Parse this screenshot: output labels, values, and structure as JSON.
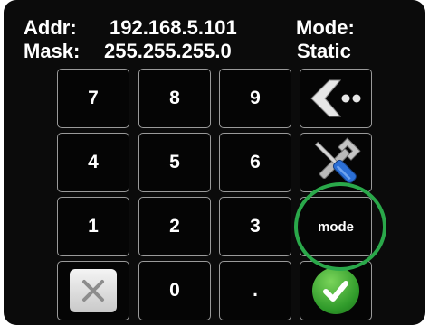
{
  "status": {
    "addr_label": "Addr:",
    "addr_value": "192.168.5.101",
    "mask_label": "Mask:",
    "mask_value": "255.255.255.0",
    "mode_label": "Mode:",
    "mode_value": "Static"
  },
  "keypad": {
    "keys": [
      "7",
      "8",
      "9",
      "4",
      "5",
      "6",
      "1",
      "2",
      "3",
      "0",
      "."
    ],
    "mode_button": "mode"
  },
  "icons": {
    "back": "back-arrow-icon",
    "settings": "tools-icon",
    "clear": "clear-x-icon",
    "confirm": "checkmark-icon"
  },
  "colors": {
    "background": "#0b0b0b",
    "key_border": "#9a9a9a",
    "highlight_ring": "#2aa84a",
    "confirm_green": "#3fae34"
  }
}
